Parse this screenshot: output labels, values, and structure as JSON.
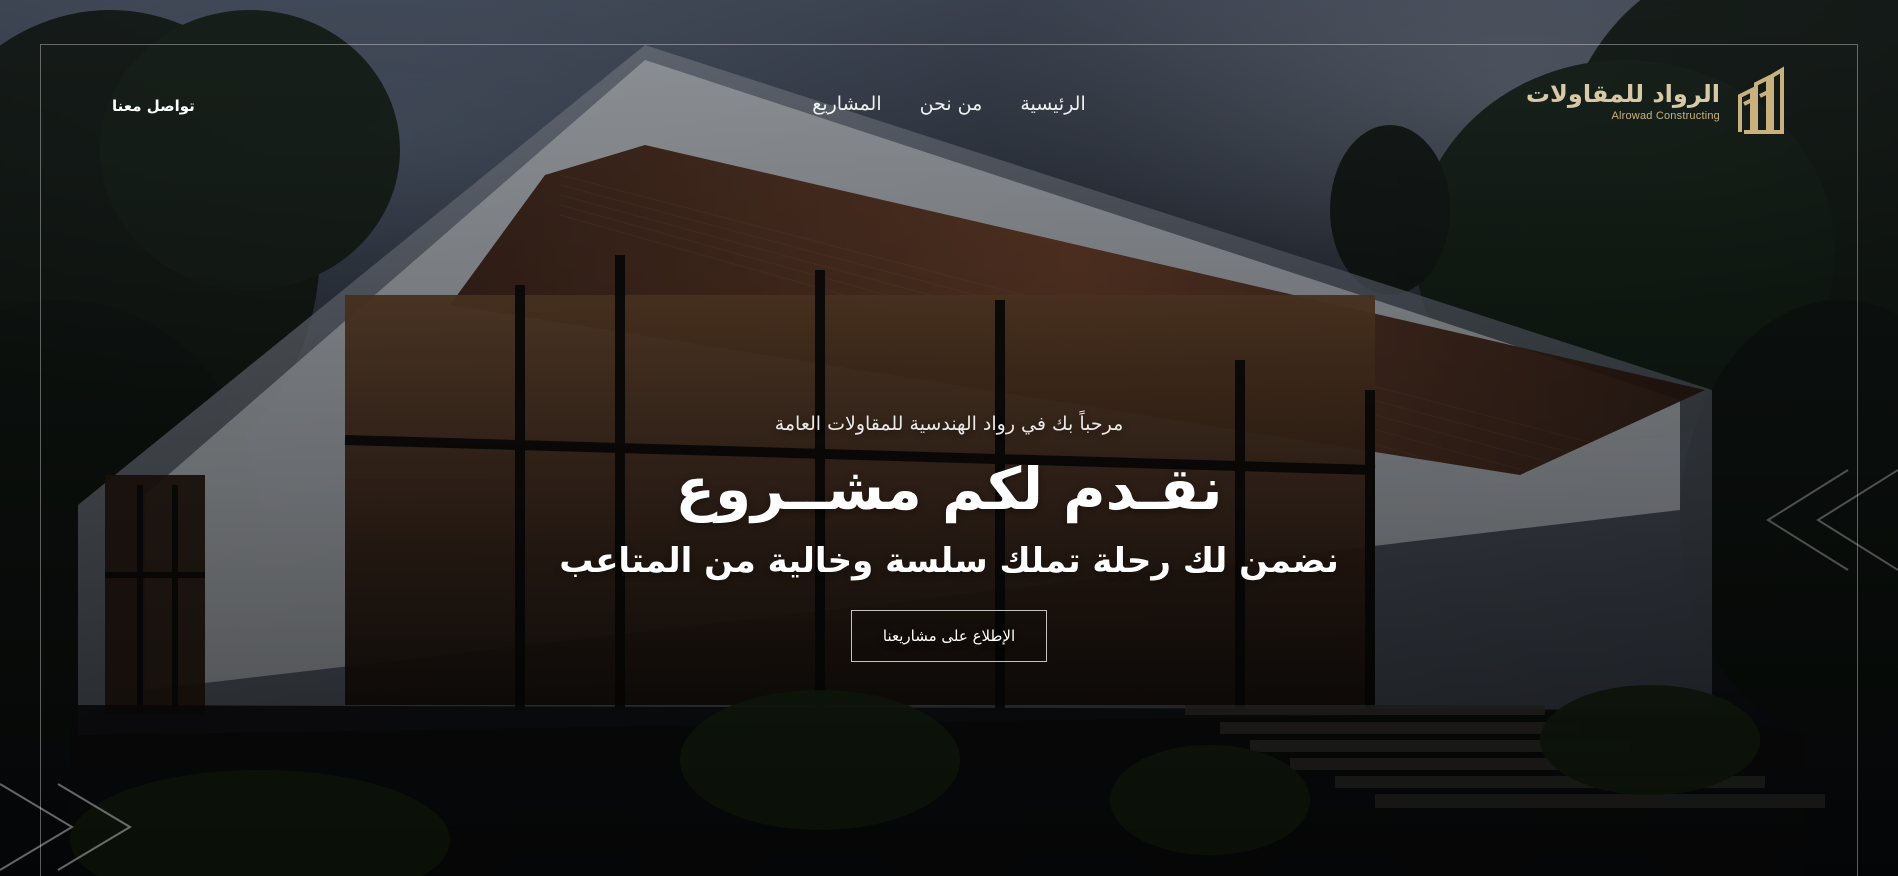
{
  "brand": {
    "name_ar": "الرواد للمقاولات",
    "name_en": "Alrowad Constructing",
    "accent": "#c9b17f",
    "logo_icon": "building-logo-icon"
  },
  "nav": {
    "items": [
      {
        "label": "الرئيسية"
      },
      {
        "label": "من نحن"
      },
      {
        "label": "المشاريع"
      }
    ],
    "contact_label": "تواصل معنا"
  },
  "hero": {
    "welcome": "مرحباً بك في رواد الهندسية للمقاولات العامة",
    "title": "نقـدم لكم مشــروع",
    "subtitle": "نضمن لك رحلة تملك سلسة وخالية من المتاعب",
    "cta_label": "الإطلاع على مشاريعنا"
  },
  "background": {
    "subject": "modern single-story house at dusk with trees",
    "overlay_color": "#000000"
  },
  "decorations": {
    "left_icon": "double-chevron-right-icon",
    "right_icon": "double-chevron-left-icon"
  }
}
